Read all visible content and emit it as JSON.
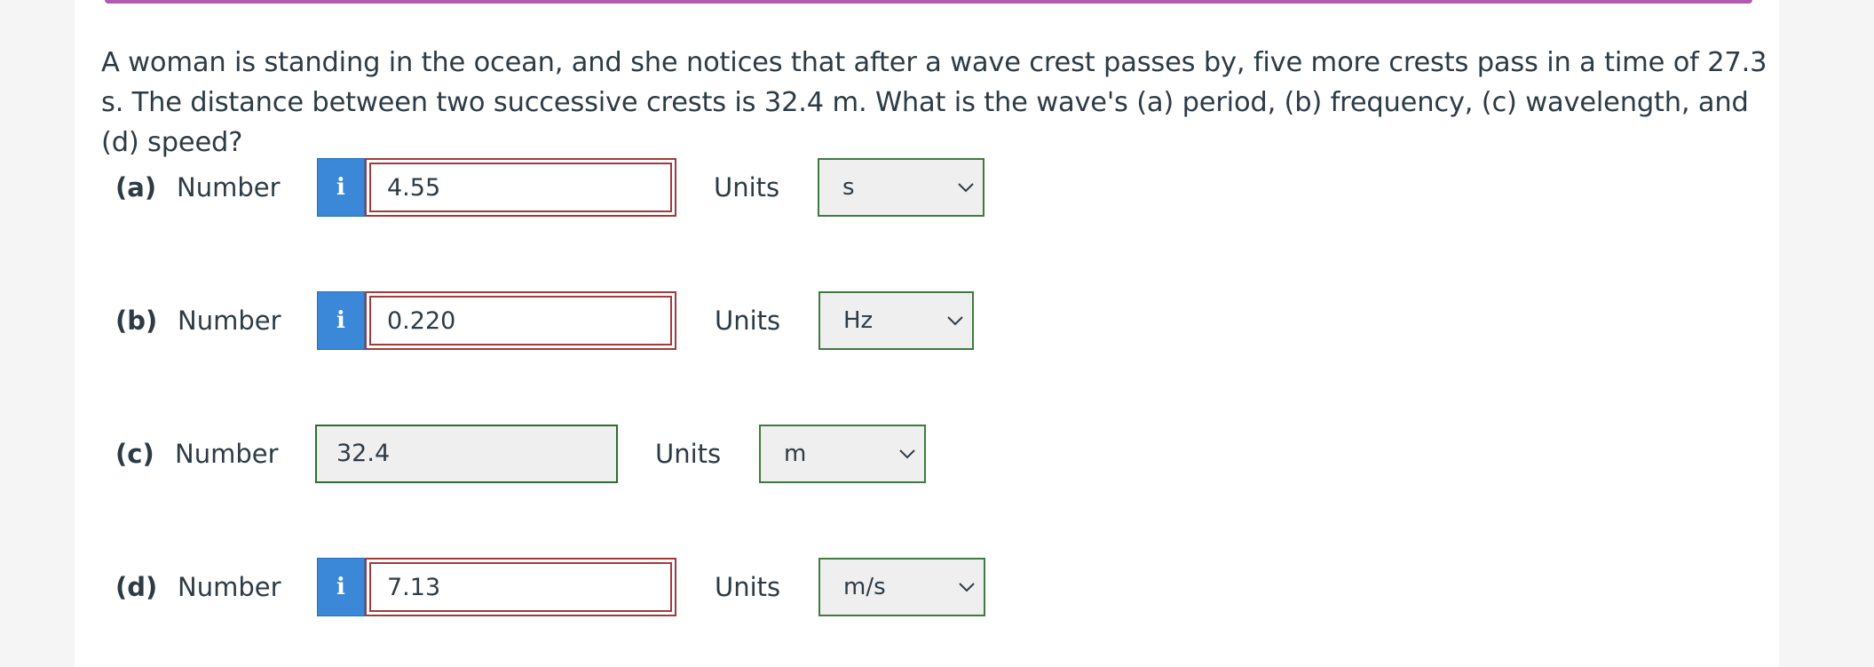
{
  "question": "A woman is standing in the ocean, and she notices that after a wave crest passes by, five more crests pass in a time of 27.3 s. The distance between two successive crests is 32.4 m. What is the wave's (a) period, (b) frequency, (c) wavelength, and (d) speed?",
  "number_label": "Number",
  "units_label": "Units",
  "info_glyph": "i",
  "parts": [
    {
      "label": "(a)",
      "value": "4.55",
      "unit": "s",
      "status": "incorrect"
    },
    {
      "label": "(b)",
      "value": "0.220",
      "unit": "Hz",
      "status": "incorrect"
    },
    {
      "label": "(c)",
      "value": "32.4",
      "unit": "m",
      "status": "correct"
    },
    {
      "label": "(d)",
      "value": "7.13",
      "unit": "m/s",
      "status": "incorrect"
    }
  ],
  "colors": {
    "incorrect_border": "#a33a3a",
    "correct_border": "#2e6b2e",
    "info_button": "#3b88d8",
    "top_bar": "#b05ab0"
  }
}
